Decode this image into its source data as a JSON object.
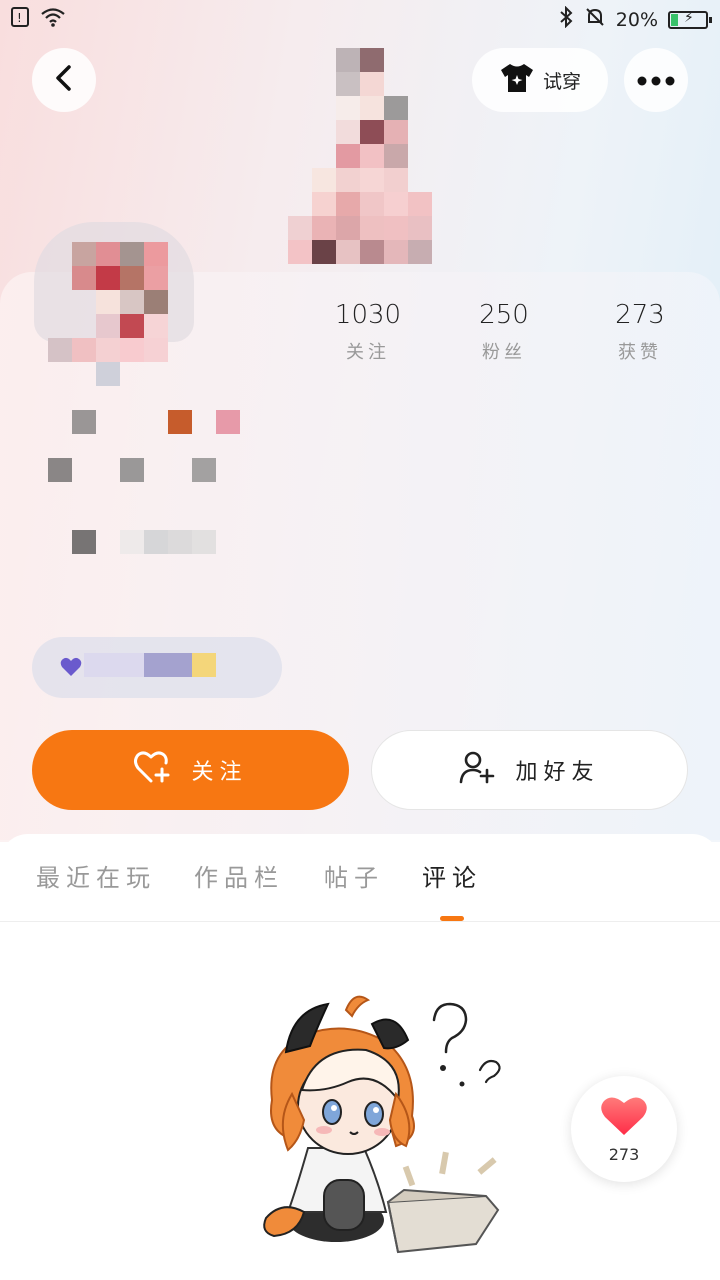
{
  "status_bar": {
    "battery_percent": "20%",
    "battery_level": 0.2
  },
  "header": {
    "try_on_label": "试穿"
  },
  "profile": {
    "stats": [
      {
        "value": "1030",
        "label": "关注"
      },
      {
        "value": "250",
        "label": "粉丝"
      },
      {
        "value": "273",
        "label": "获赞"
      }
    ]
  },
  "actions": {
    "follow_label": "关注",
    "add_friend_label": "加好友"
  },
  "tabs": [
    {
      "label": "最近在玩",
      "active": false
    },
    {
      "label": "作品栏",
      "active": false
    },
    {
      "label": "帖子",
      "active": false
    },
    {
      "label": "评论",
      "active": true
    }
  ],
  "empty_state": {
    "illustration": "confused-mascot-with-empty-box"
  },
  "floating_like": {
    "count": "273"
  },
  "colors": {
    "accent": "#f77712",
    "heart": "#ff3b50",
    "badge_heart": "#6a5acd"
  }
}
